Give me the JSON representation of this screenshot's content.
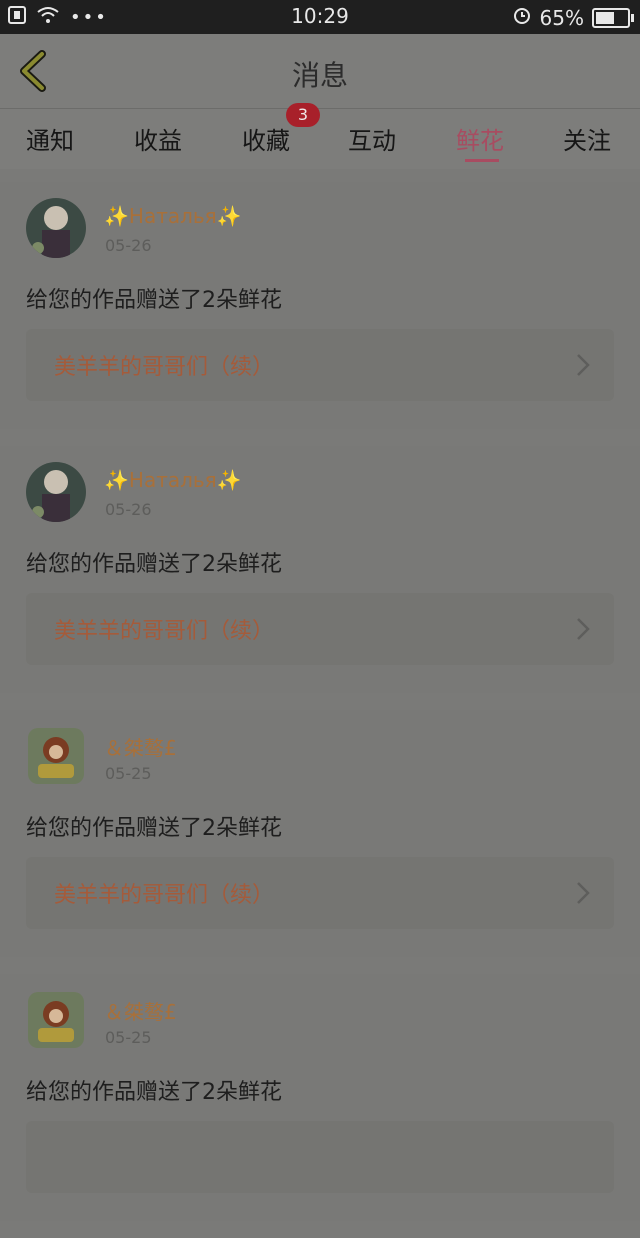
{
  "status": {
    "time": "10:29",
    "battery": "65%",
    "battery_level": 0.65
  },
  "header": {
    "title": "消息"
  },
  "tabs": [
    {
      "label": "通知",
      "active": false
    },
    {
      "label": "收益",
      "active": false
    },
    {
      "label": "收藏",
      "active": false,
      "badge": "3"
    },
    {
      "label": "互动",
      "active": false
    },
    {
      "label": "鲜花",
      "active": true
    },
    {
      "label": "关注",
      "active": false
    }
  ],
  "items": [
    {
      "user": "✨Наталья✨",
      "date": "05-26",
      "message": "给您的作品赠送了2朵鲜花",
      "work": "美羊羊的哥哥们（续）"
    },
    {
      "user": "✨Наталья✨",
      "date": "05-26",
      "message": "给您的作品赠送了2朵鲜花",
      "work": "美羊羊的哥哥们（续）"
    },
    {
      "user": "＆桀骜£",
      "date": "05-25",
      "message": "给您的作品赠送了2朵鲜花",
      "work": "美羊羊的哥哥们（续）"
    },
    {
      "user": "＆桀骜£",
      "date": "05-25",
      "message": "给您的作品赠送了2朵鲜花",
      "work": ""
    }
  ],
  "colors": {
    "accent": "#a84c61",
    "badge": "#a8202a",
    "username": "#a8703a",
    "work_title": "#a55b3a"
  }
}
